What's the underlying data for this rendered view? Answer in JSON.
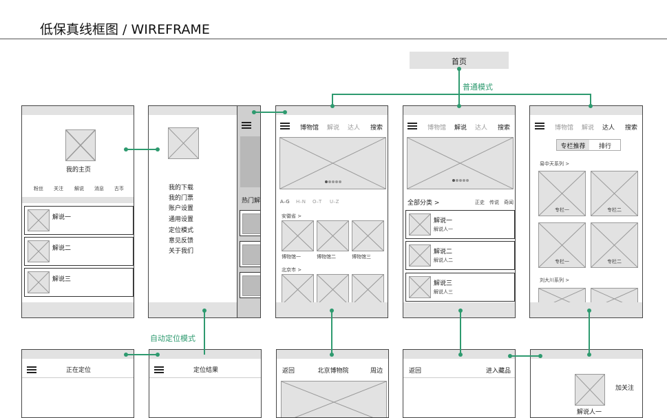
{
  "header": {
    "title": "低保真线框图 / WIREFRAME"
  },
  "home_node": "首页",
  "flow_labels": {
    "normal_mode": "普通模式",
    "auto_mode": "自动定位模式"
  },
  "my_home": {
    "title": "我的主页",
    "stats": [
      "粉丝",
      "关注",
      "解说",
      "消息",
      "古币"
    ],
    "items": [
      "解说一",
      "解说二",
      "解说三"
    ]
  },
  "drawer": {
    "items": [
      "我的下载",
      "我的门票",
      "账户设置",
      "通用设置",
      "定位模式",
      "意见反馈",
      "关于我们"
    ],
    "peek_text": "热门解"
  },
  "tabs": [
    "博物馆",
    "解说",
    "达人",
    "搜索"
  ],
  "museum_tab": {
    "filters": [
      "A–G",
      "H–N",
      "O–T",
      "U–Z"
    ],
    "province": "安徽省 >",
    "museums": [
      "博物馆一",
      "博物馆二",
      "博物馆三"
    ],
    "city": "北京市 >"
  },
  "narration_tab": {
    "category": "全部分类 >",
    "sort": [
      "正史",
      "传说",
      "奇闻"
    ],
    "items": [
      {
        "title": "解说一",
        "sub": "解说人一"
      },
      {
        "title": "解说二",
        "sub": "解说人二"
      },
      {
        "title": "解说三",
        "sub": "解说人三"
      }
    ]
  },
  "expert_tab": {
    "toggle": [
      "专栏推荐",
      "排行"
    ],
    "series1": "易中天系列 >",
    "columns": [
      "专栏一",
      "专栏二",
      "专栏一",
      "专栏二"
    ],
    "series2": "刘大川系列 >"
  },
  "locating": {
    "title": "正在定位"
  },
  "location_result": {
    "title": "定位结果"
  },
  "museum_detail": {
    "back": "返回",
    "title": "北京博物院",
    "nearby": "周边"
  },
  "narration_detail": {
    "back": "返回",
    "collect": "进入藏品"
  },
  "expert_detail": {
    "follow": "加关注",
    "name": "解说人一"
  }
}
